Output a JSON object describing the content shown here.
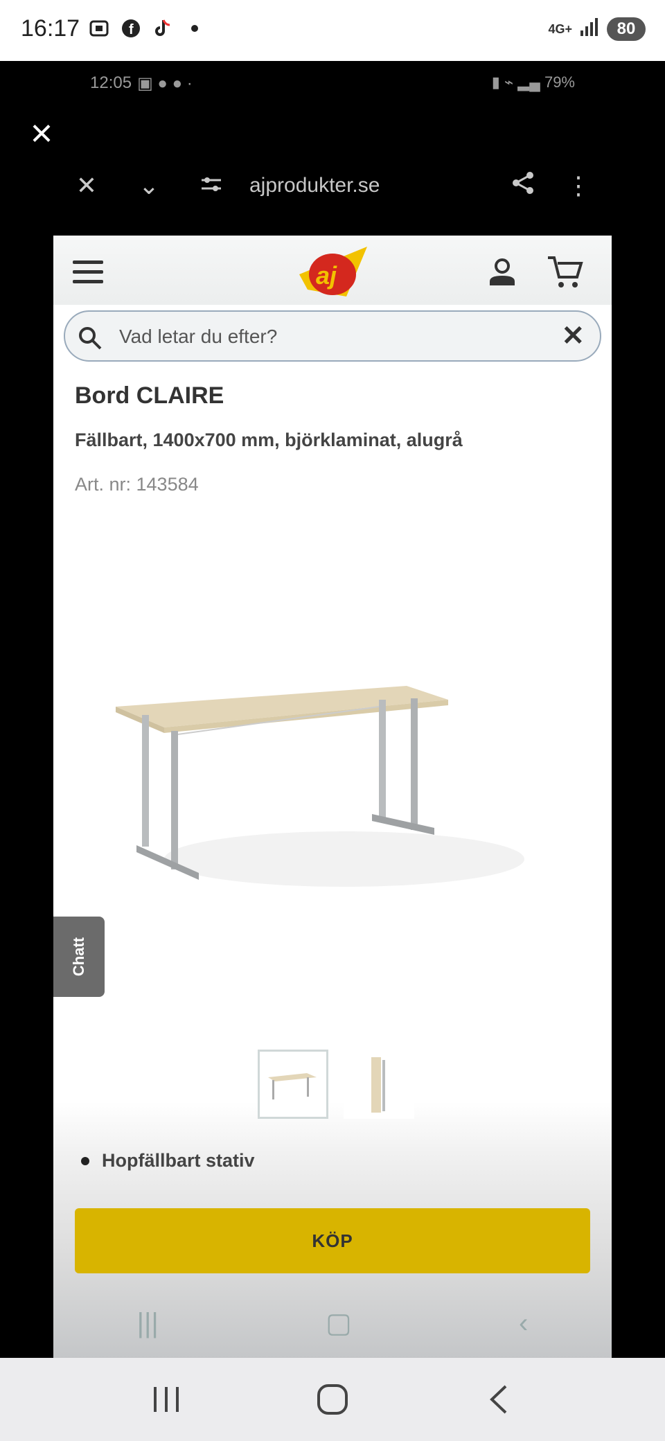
{
  "status_bar": {
    "time": "16:17",
    "network": "4G+",
    "battery": "80"
  },
  "viewer": {
    "close_label": "×",
    "inner_status_time": "12:05",
    "inner_status_battery": "79%",
    "url": "ajprodukter.se"
  },
  "site": {
    "search_placeholder": "Vad letar du efter?",
    "product": {
      "title": "Bord CLAIRE",
      "subtitle": "Fällbart, 1400x700 mm, björklaminat, alugrå",
      "art_nr": "Art. nr: 143584"
    },
    "chat_label": "Chatt",
    "feature": "Hopfällbart stativ",
    "buy_label": "KÖP"
  },
  "colors": {
    "buy_button": "#d8b400",
    "logo_red": "#d4281e",
    "logo_yellow": "#f2c200"
  }
}
